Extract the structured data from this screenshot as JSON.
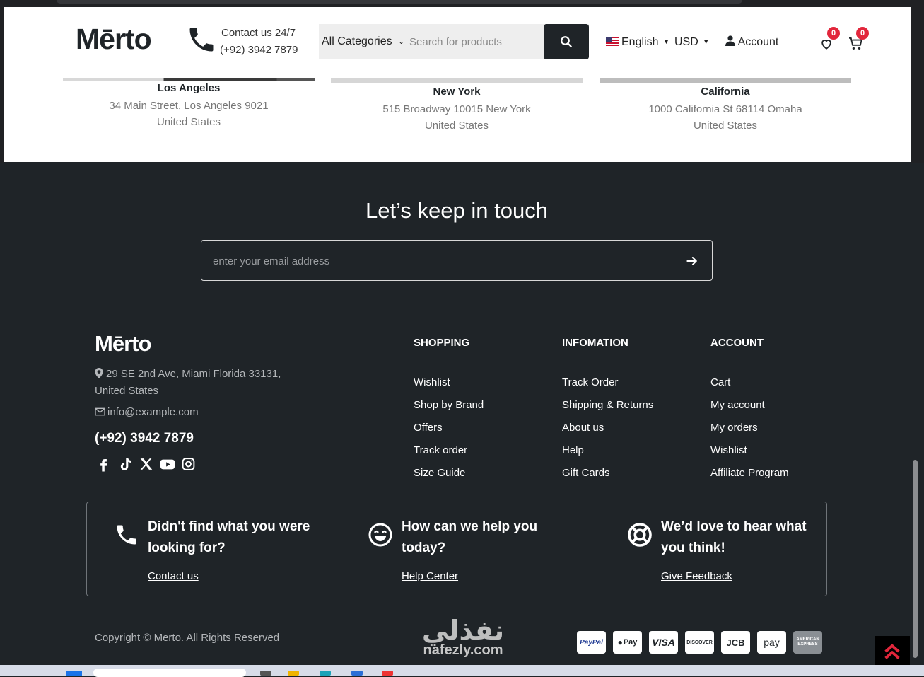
{
  "header": {
    "logo": "Mērto",
    "contact_line1": "Contact us 24/7",
    "contact_line2": "(+92) 3942 7879",
    "category": "All Categories",
    "search_placeholder": "Search for products",
    "language": "English",
    "currency": "USD",
    "account": "Account",
    "wishlist_count": "0",
    "cart_count": "0"
  },
  "stores": [
    {
      "city": "Los Angeles",
      "address": "34 Main Street, Los Angeles 9021",
      "country": "United States"
    },
    {
      "city": "New York",
      "address": "515 Broadway 10015 New York",
      "country": "United States"
    },
    {
      "city": "California",
      "address": "1000 California St 68114 Omaha",
      "country": "United States"
    }
  ],
  "newsletter": {
    "title": "Let’s keep in touch",
    "placeholder": "enter your email address"
  },
  "footer": {
    "logo": "Mērto",
    "address": "29 SE 2nd Ave, Miami Florida 33131, United States",
    "email": "info@example.com",
    "phone": "(+92) 3942 7879",
    "social_icons": [
      "facebook-icon",
      "tiktok-icon",
      "x-icon",
      "youtube-icon",
      "instagram-icon"
    ],
    "columns": [
      {
        "title": "SHOPPING",
        "items": [
          "Wishlist",
          "Shop by Brand",
          "Offers",
          "Track order",
          "Size Guide"
        ]
      },
      {
        "title": "INFOMATION",
        "items": [
          "Track Order",
          "Shipping & Returns",
          "About us",
          "Help",
          "Gift Cards"
        ]
      },
      {
        "title": "ACCOUNT",
        "items": [
          "Cart",
          "My account",
          "My orders",
          "Wishlist",
          "Affiliate Program"
        ]
      }
    ],
    "help": [
      {
        "title": "Didn't find what you were looking for?",
        "link": "Contact us",
        "icon": "phone-icon"
      },
      {
        "title": "How can we help you today?",
        "link": "Help Center",
        "icon": "smile-icon"
      },
      {
        "title": "We’d love to hear what you think!",
        "link": "Give Feedback",
        "icon": "lifebuoy-icon"
      }
    ],
    "copyright": "Copyright © Merto. All Rights Reserved",
    "payments": [
      "PayPal",
      "Pay",
      "VISA",
      "DISCOVER",
      "JCB",
      "pay",
      "AMERICAN EXPRESS"
    ]
  },
  "watermark": {
    "arabic": "نفذلي",
    "latin": "nafezly.com"
  },
  "colors": {
    "accent": "#e2263b",
    "dark": "#1f2428",
    "white": "#ffffff"
  }
}
